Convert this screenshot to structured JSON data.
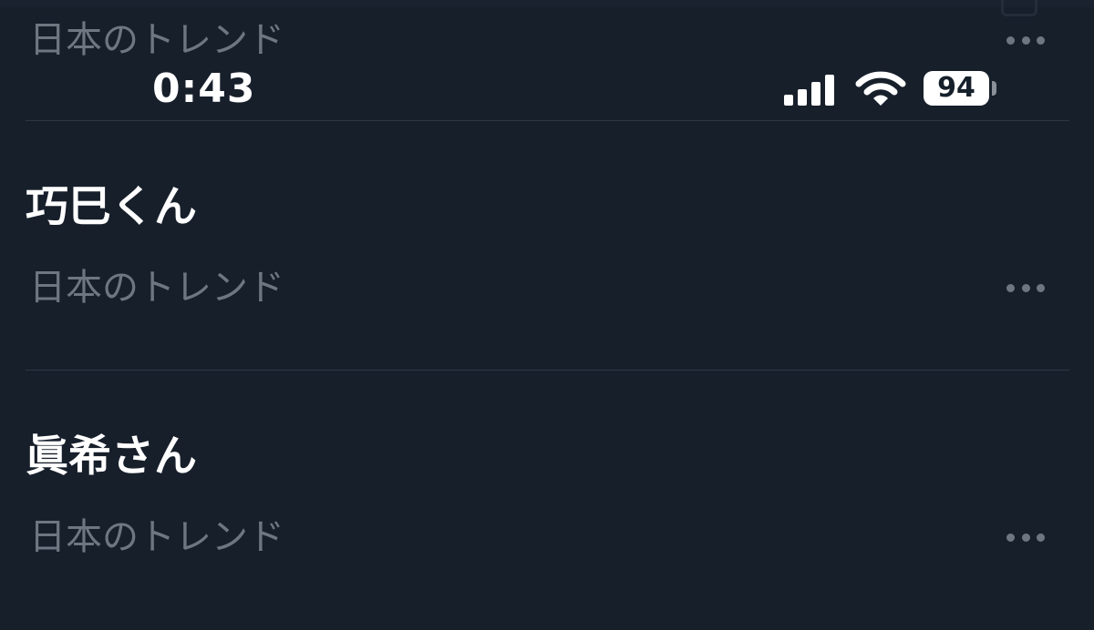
{
  "status_bar": {
    "time": "0:43",
    "battery_level": "94",
    "signal_icon": "cellular-signal-icon",
    "wifi_icon": "wifi-icon"
  },
  "trends": [
    {
      "title": "",
      "subtitle": "日本のトレンド"
    },
    {
      "title": "巧巳くん",
      "subtitle": "日本のトレンド"
    },
    {
      "title": "眞希さん",
      "subtitle": "日本のトレンド"
    }
  ],
  "colors": {
    "background": "#171f2b",
    "primary_text": "#ffffff",
    "secondary_text": "#6e7781",
    "divider": "#2f3842"
  }
}
